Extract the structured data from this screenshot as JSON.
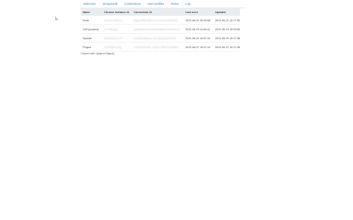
{
  "nav": {
    "tabs": [
      "Welcome",
      "Groupsodd",
      "Connections",
      "User profiles",
      "Rules",
      "Log"
    ]
  },
  "table": {
    "headers": [
      "Name",
      "Chrome Instance Id",
      "Connection Id",
      "Last seen",
      "Updated"
    ],
    "rows": [
      {
        "name": "Work",
        "chrome_id": "hRxeN-nKeUx",
        "connection_id": "b6gaZ8RKcBkuqXrH3wi2mNkWdS",
        "last_seen": "2021-06-21 09:39:55",
        "updated": "2021-06-21 10:17:52"
      },
      {
        "name": "Cell (ocolent)",
        "chrome_id": "vL7FBbgZf",
        "connection_id": "qaNaMW4CDsQF9H8NhO2wGHPKR",
        "last_seen": "2021-06-25 11:04:21",
        "updated": "2021-06-19 10:03:50"
      },
      {
        "name": "Spouse",
        "chrome_id": "90SRSbxGYFi",
        "connection_id": "SoZNFNM0qvJ-btLaRq2wGHPKR",
        "last_seen": "2021-06-21 10:57:41",
        "updated": "2021-06-21 10:17:38"
      },
      {
        "name": "Project",
        "chrome_id": "kH3N6R0G5g",
        "connection_id": "x7dj1UmD4kL-9nQK-rtWxEZ4e8NH",
        "last_seen": "2021-06-27 10:07:41",
        "updated": "2021-06-27 10:17:45"
      }
    ]
  },
  "status": {
    "closed_text": "Closed with: [object Object]"
  }
}
